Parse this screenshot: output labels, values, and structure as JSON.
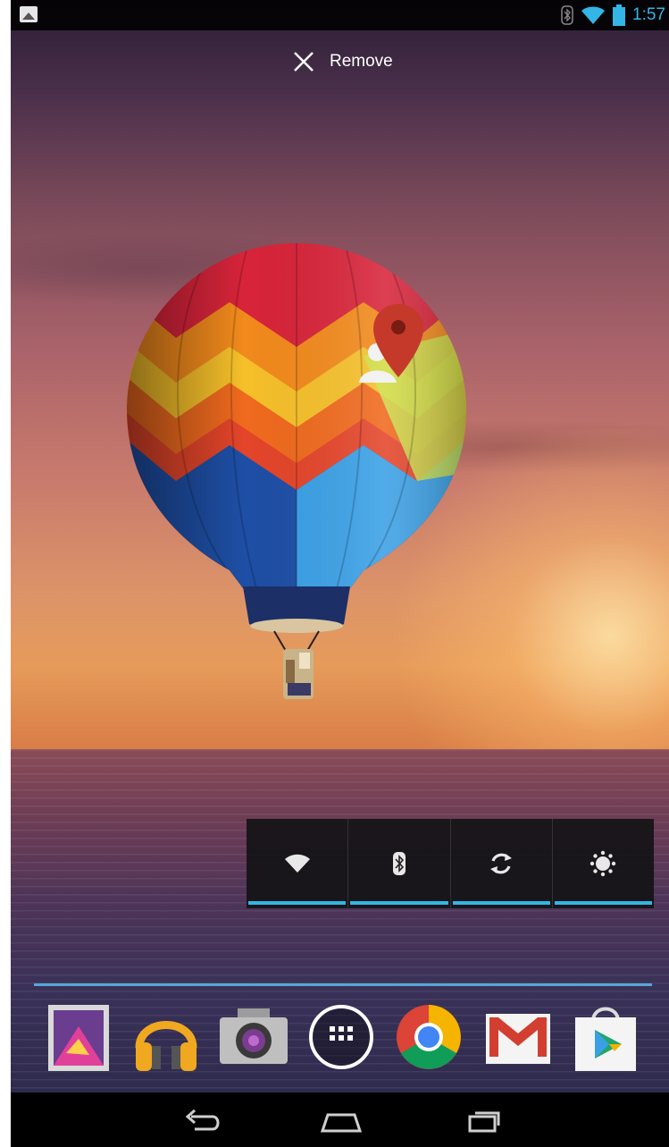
{
  "status_bar": {
    "time": "1:57",
    "icons": [
      "gallery-notification-icon",
      "bluetooth-icon",
      "wifi-icon",
      "battery-icon"
    ]
  },
  "remove_target": {
    "label": "Remove",
    "icon": "close-icon"
  },
  "wallpaper": {
    "subject": "hot-air-balloon-over-sea-at-sunset"
  },
  "dragged_item": {
    "icons": [
      "map-pin-icon",
      "person-icon"
    ]
  },
  "power_control": {
    "toggles": [
      {
        "name": "wifi",
        "icon": "wifi-icon",
        "on": true
      },
      {
        "name": "bluetooth",
        "icon": "bluetooth-icon",
        "on": true
      },
      {
        "name": "sync",
        "icon": "sync-icon",
        "on": true
      },
      {
        "name": "brightness",
        "icon": "brightness-icon",
        "on": true
      }
    ],
    "indicator_color": "#33b5e5"
  },
  "dock": {
    "apps": [
      {
        "name": "gallery",
        "icon": "gallery-icon"
      },
      {
        "name": "play-music",
        "icon": "headphones-icon"
      },
      {
        "name": "camera",
        "icon": "camera-icon"
      },
      {
        "name": "all-apps",
        "icon": "app-drawer-icon"
      },
      {
        "name": "chrome",
        "icon": "chrome-icon"
      },
      {
        "name": "gmail",
        "icon": "gmail-icon"
      },
      {
        "name": "play-store",
        "icon": "play-store-icon"
      }
    ]
  },
  "nav_bar": {
    "buttons": [
      "back",
      "home",
      "recents"
    ]
  },
  "colors": {
    "accent": "#33b5e5",
    "status_bar": "#000000"
  }
}
